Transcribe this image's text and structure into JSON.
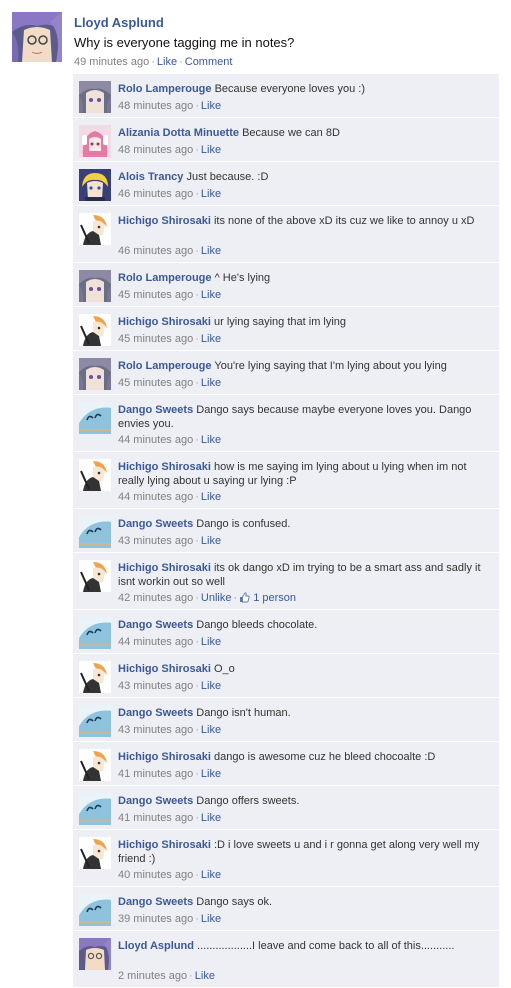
{
  "post": {
    "name": "Lloyd Asplund",
    "text": "Why is everyone tagging me in notes?",
    "time": "49 minutes ago",
    "like": "Like",
    "comment": "Comment"
  },
  "comments": [
    {
      "name": "Rolo Lamperouge",
      "text": "Because everyone loves you :)",
      "time": "48 minutes ago",
      "like": "Like",
      "avatar": "rolo"
    },
    {
      "name": "Alizania Dotta Minuette",
      "text": "Because we can 8D",
      "time": "48 minutes ago",
      "like": "Like",
      "avatar": "alizania"
    },
    {
      "name": "Alois Trancy",
      "text": "Just because. :D",
      "time": "46 minutes ago",
      "like": "Like",
      "avatar": "alois"
    },
    {
      "name": "Hichigo Shirosaki",
      "text": "its none of the above xD its cuz we like to annoy u xD",
      "time": "46 minutes ago",
      "like": "Like",
      "avatar": "hichigo"
    },
    {
      "name": "Rolo Lamperouge",
      "text": "^ He's lying",
      "time": "45 minutes ago",
      "like": "Like",
      "avatar": "rolo"
    },
    {
      "name": "Hichigo Shirosaki",
      "text": "ur lying saying that im lying",
      "time": "45 minutes ago",
      "like": "Like",
      "avatar": "hichigo"
    },
    {
      "name": "Rolo Lamperouge",
      "text": "You're lying saying that I'm lying about you lying",
      "time": "45 minutes ago",
      "like": "Like",
      "avatar": "rolo"
    },
    {
      "name": "Dango Sweets",
      "text": "Dango says because maybe everyone loves you. Dango envies you.",
      "time": "44 minutes ago",
      "like": "Like",
      "avatar": "dango"
    },
    {
      "name": "Hichigo Shirosaki",
      "text": "how is me saying im lying about u lying when im not really lying about u saying ur lying :P",
      "time": "44 minutes ago",
      "like": "Like",
      "avatar": "hichigo"
    },
    {
      "name": "Dango Sweets",
      "text": "Dango is confused.",
      "time": "43 minutes ago",
      "like": "Like",
      "avatar": "dango"
    },
    {
      "name": "Hichigo Shirosaki",
      "text": "its ok dango xD im trying to be a smart ass and sadly it isnt workin out so well",
      "time": "42 minutes ago",
      "like": "Unlike",
      "likes": "1 person",
      "avatar": "hichigo"
    },
    {
      "name": "Dango Sweets",
      "text": "Dango bleeds chocolate.",
      "time": "44 minutes ago",
      "like": "Like",
      "avatar": "dango"
    },
    {
      "name": "Hichigo Shirosaki",
      "text": "O_o",
      "time": "43 minutes ago",
      "like": "Like",
      "avatar": "hichigo"
    },
    {
      "name": "Dango Sweets",
      "text": "Dango isn't human.",
      "time": "43 minutes ago",
      "like": "Like",
      "avatar": "dango"
    },
    {
      "name": "Hichigo Shirosaki",
      "text": "dango is awesome cuz he bleed chocoalte :D",
      "time": "41 minutes ago",
      "like": "Like",
      "avatar": "hichigo"
    },
    {
      "name": "Dango Sweets",
      "text": "Dango offers sweets.",
      "time": "41 minutes ago",
      "like": "Like",
      "avatar": "dango"
    },
    {
      "name": "Hichigo Shirosaki",
      "text": ":D i love sweets u and i r gonna get along very well my friend :)",
      "time": "40 minutes ago",
      "like": "Like",
      "avatar": "hichigo"
    },
    {
      "name": "Dango Sweets",
      "text": "Dango says ok.",
      "time": "39 minutes ago",
      "like": "Like",
      "avatar": "dango"
    },
    {
      "name": "Lloyd Asplund",
      "text": "..................I leave and come back to all of this...........",
      "time": "2 minutes ago",
      "like": "Like",
      "avatar": "lloyd"
    }
  ],
  "colors": {
    "link": "#3b5998",
    "comment_bg": "#edeff4",
    "meta": "#808080"
  }
}
